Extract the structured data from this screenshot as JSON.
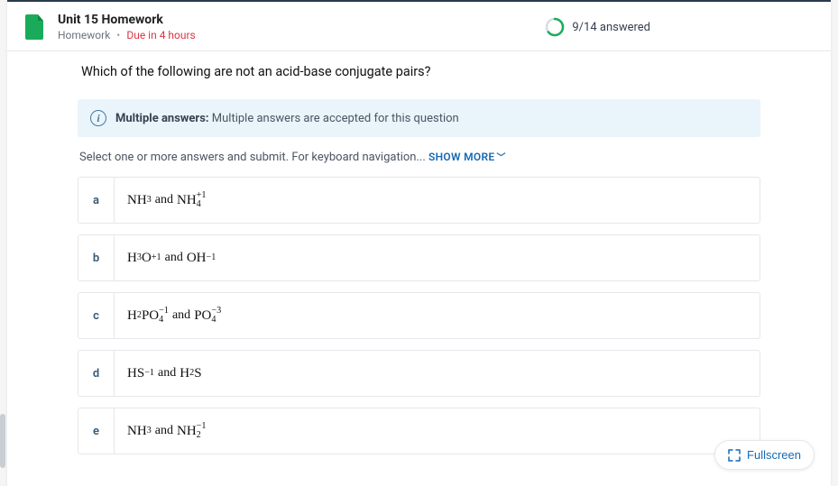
{
  "header": {
    "title": "Unit 15 Homework",
    "subtitle_label": "Homework",
    "due_label": "Due in 4 hours",
    "progress_label": "9/14 answered"
  },
  "question": {
    "text": "Which of the following are not an acid-base conjugate pairs?"
  },
  "info_banner": {
    "bold_label": "Multiple answers:",
    "text": "Multiple answers are accepted for this question"
  },
  "instruction": {
    "text": "Select one or more answers and submit. For keyboard navigation...",
    "show_more_label": "SHOW MORE"
  },
  "options": [
    {
      "letter": "a",
      "html_key": "opt_a"
    },
    {
      "letter": "b",
      "html_key": "opt_b"
    },
    {
      "letter": "c",
      "html_key": "opt_c"
    },
    {
      "letter": "d",
      "html_key": "opt_d"
    },
    {
      "letter": "e",
      "html_key": "opt_e"
    }
  ],
  "option_formulas": {
    "opt_a": {
      "left_base": "NH",
      "left_sub": "3",
      "and": "and",
      "right_base": "NH",
      "right_subsup_top": "+1",
      "right_subsup_bot": "4"
    },
    "opt_b": {
      "left_base": "H",
      "left_sub": "3",
      "left_mid": "O",
      "left_sup": "+1",
      "and": "and",
      "right_base": "OH",
      "right_sup": "−1"
    },
    "opt_c": {
      "left_base": "H",
      "left_sub": "2",
      "left_mid": "PO",
      "left_subsup_top": "−1",
      "left_subsup_bot": "4",
      "and": "and",
      "right_base": "PO",
      "right_subsup_top": "−3",
      "right_subsup_bot": "4"
    },
    "opt_d": {
      "left_base": "HS",
      "left_sup": "−1",
      "and": "and",
      "right_base": "H",
      "right_sub": "2",
      "right_mid": "S"
    },
    "opt_e": {
      "left_base": "NH",
      "left_sub": "3",
      "and": "and",
      "right_base": "NH",
      "right_subsup_top": "−1",
      "right_subsup_bot": "2"
    }
  },
  "fullscreen_label": "Fullscreen"
}
